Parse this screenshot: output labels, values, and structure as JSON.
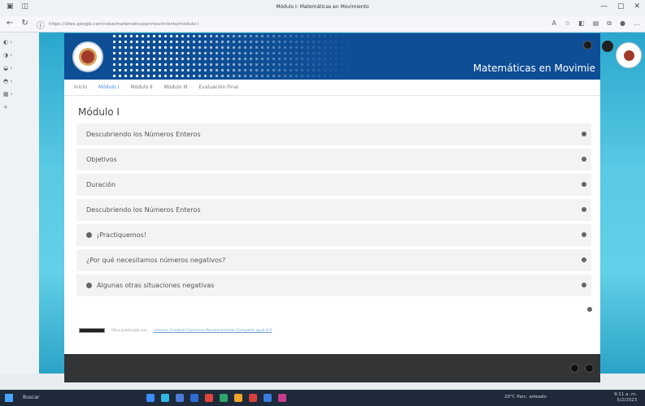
{
  "browser": {
    "window_title": "Módulo I: Matemáticas en Movimiento",
    "url": "https://sites.google.com/view/matematicasenmovimiento/modulo-i",
    "window_controls": [
      "—",
      "▢",
      "✕"
    ]
  },
  "site": {
    "banner_title": "Matemáticas en Movimie",
    "nav": [
      "Inicio",
      "Módulo I",
      "Módulo II",
      "Módulo III",
      "Evaluación Final"
    ],
    "active_nav_index": 1,
    "module_title": "Módulo I",
    "items": [
      {
        "label": "Descubriendo los Números Enteros",
        "bullet": false
      },
      {
        "label": "Objetivos",
        "bullet": false
      },
      {
        "label": "Duración",
        "bullet": false
      },
      {
        "label": "Descubriendo los Números Enteros",
        "bullet": false
      },
      {
        "label": "¡Practiquemos!",
        "bullet": true
      },
      {
        "label": "¿Por qué necesitamos números negativos?",
        "bullet": false
      },
      {
        "label": "Algunas otras situaciones negativas",
        "bullet": true
      }
    ],
    "license_text": "Obra publicada con",
    "license_link": "Licencia Creative Commons Reconocimiento Compartir igual 4.0"
  },
  "taskbar": {
    "search_label": "Buscar",
    "weather": "20°C Parc. soleado",
    "time": "9:11 a. m.",
    "date": "5/2/2023"
  },
  "colors": {
    "banner": "#0d4e95",
    "teal": "#59c9e4",
    "footer": "#333436",
    "active_nav": "#4a8ee6"
  }
}
